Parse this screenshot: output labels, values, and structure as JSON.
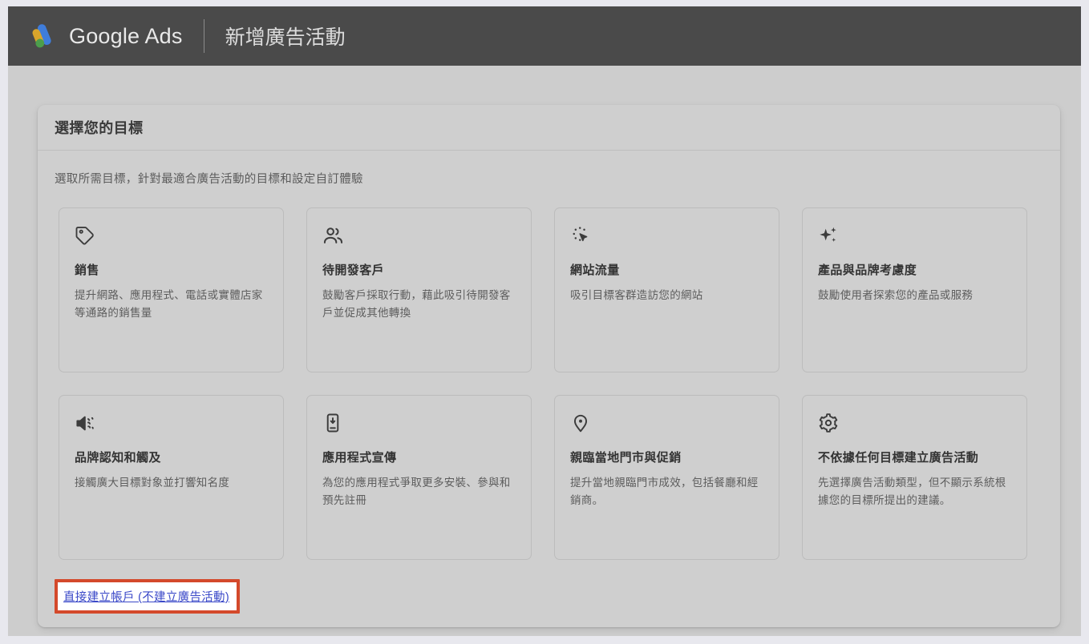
{
  "appbar": {
    "logo_icon": "google-ads-logo",
    "brand": "Google Ads",
    "page_subject": "新增廣告活動",
    "colors": {
      "background": "#4a4a4a",
      "logo_yellow": "#d9a52b",
      "logo_green": "#4c9e4c",
      "logo_blue": "#3f7ddb"
    }
  },
  "card": {
    "title": "選擇您的目標",
    "subtitle": "選取所需目標，針對最適合廣告活動的目標和設定自訂體驗"
  },
  "goals": [
    {
      "icon": "tag-icon",
      "name": "銷售",
      "desc": "提升網路、應用程式、電話或實體店家等通路的銷售量"
    },
    {
      "icon": "people-icon",
      "name": "待開發客戶",
      "desc": "鼓勵客戶採取行動，藉此吸引待開發客戶並促成其他轉換"
    },
    {
      "icon": "ads-click-icon",
      "name": "網站流量",
      "desc": "吸引目標客群造訪您的網站"
    },
    {
      "icon": "sparkle-icon",
      "name": "產品與品牌考慮度",
      "desc": "鼓勵使用者探索您的產品或服務"
    },
    {
      "icon": "speaker-icon",
      "name": "品牌認知和觸及",
      "desc": "接觸廣大目標對象並打響知名度"
    },
    {
      "icon": "app-install-icon",
      "name": "應用程式宣傳",
      "desc": "為您的應用程式爭取更多安裝、參與和預先註冊"
    },
    {
      "icon": "location-pin-icon",
      "name": "親臨當地門市與促銷",
      "desc": "提升當地親臨門市成效，包括餐廳和經銷商。"
    },
    {
      "icon": "gear-icon",
      "name": "不依據任何目標建立廣告活動",
      "desc": "先選擇廣告活動類型，但不顯示系統根據您的目標所提出的建議。"
    }
  ],
  "footer": {
    "account_link": "直接建立帳戶 (不建立廣告活動)",
    "link_color": "#3a48c8",
    "highlight_border_color": "#d4492b"
  }
}
